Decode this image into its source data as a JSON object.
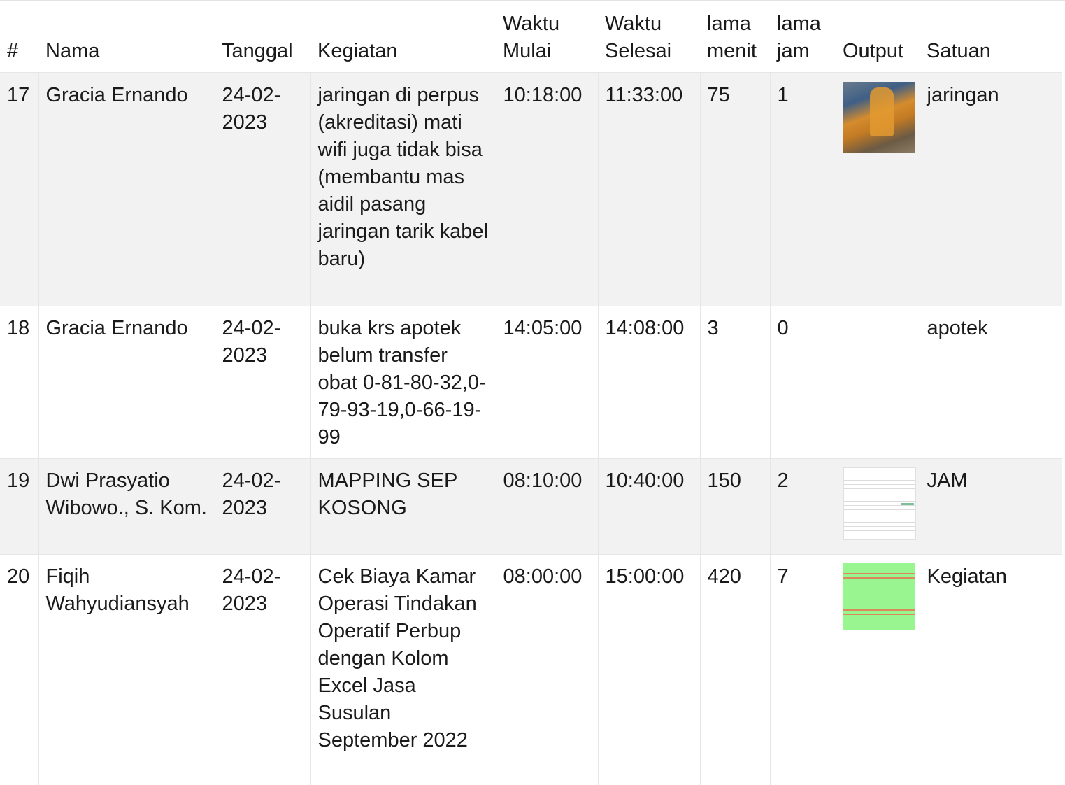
{
  "table": {
    "headers": {
      "num": "#",
      "nama": "Nama",
      "tanggal": "Tanggal",
      "kegiatan": "Kegiatan",
      "waktu_mulai_1": "Waktu",
      "waktu_mulai_2": "Mulai",
      "waktu_selesai_1": "Waktu",
      "waktu_selesai_2": "Selesai",
      "lama_menit_1": "lama",
      "lama_menit_2": "menit",
      "lama_jam_1": "lama",
      "lama_jam_2": "jam",
      "output": "Output",
      "satuan": "Satuan"
    },
    "rows": [
      {
        "num": "17",
        "nama": "Gracia Ernando",
        "tanggal": "24-02-2023",
        "kegiatan": "jaringan di perpus (akreditasi) mati wifi juga tidak bisa (membantu mas aidil pasang jaringan tarik kabel baru)",
        "waktu_mulai": "10:18:00",
        "waktu_selesai": "11:33:00",
        "lama_menit": "75",
        "lama_jam": "1",
        "output_icon": "photo-thumbnail",
        "satuan": "jaringan"
      },
      {
        "num": "18",
        "nama": "Gracia Ernando",
        "tanggal": "24-02-2023",
        "kegiatan": "buka krs apotek belum transfer obat 0-81-80-32,0-79-93-19,0-66-19-99",
        "waktu_mulai": "14:05:00",
        "waktu_selesai": "14:08:00",
        "lama_menit": "3",
        "lama_jam": "0",
        "output_icon": "",
        "satuan": "apotek"
      },
      {
        "num": "19",
        "nama": "Dwi Prasyatio Wibowo., S. Kom.",
        "tanggal": "24-02-2023",
        "kegiatan": "MAPPING SEP KOSONG",
        "waktu_mulai": "08:10:00",
        "waktu_selesai": "10:40:00",
        "lama_menit": "150",
        "lama_jam": "2",
        "output_icon": "spreadsheet-thumbnail",
        "satuan": "JAM"
      },
      {
        "num": "20",
        "nama": "Fiqih Wahyudiansyah",
        "tanggal": "24-02-2023",
        "kegiatan": "Cek Biaya Kamar Operasi Tindakan Operatif Perbup dengan Kolom Excel Jasa Susulan September 2022",
        "waktu_mulai": "08:00:00",
        "waktu_selesai": "15:00:00",
        "lama_menit": "420",
        "lama_jam": "7",
        "output_icon": "green-sheet-thumbnail",
        "satuan": "Kegiatan"
      }
    ]
  }
}
